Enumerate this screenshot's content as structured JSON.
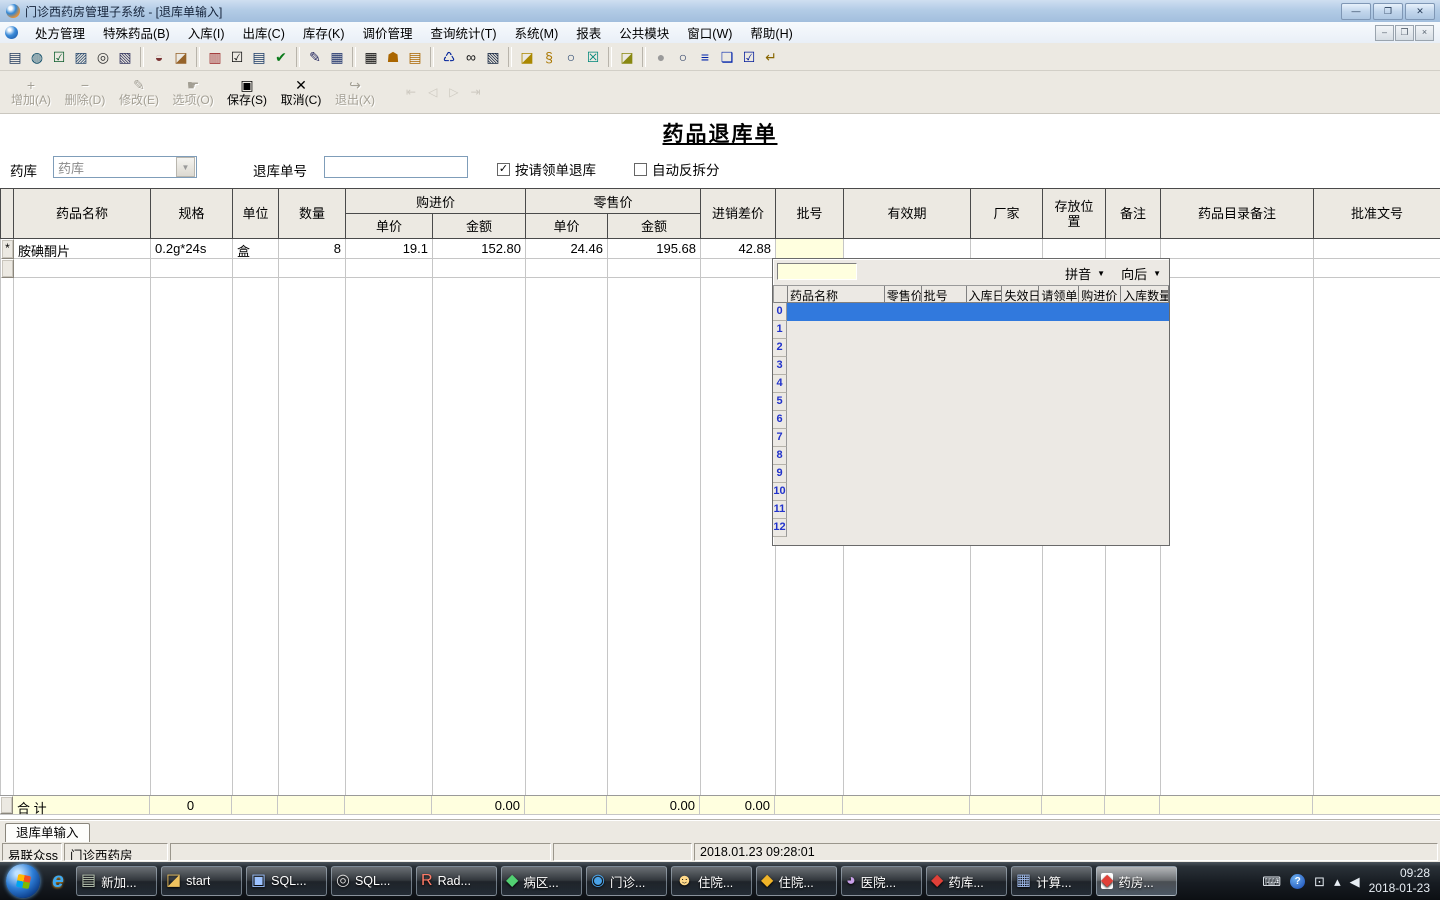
{
  "window": {
    "title": "门诊西药房管理子系统 - [退库单输入]"
  },
  "menu": {
    "items": [
      "处方管理",
      "特殊药品(B)",
      "入库(I)",
      "出库(C)",
      "库存(K)",
      "调价管理",
      "查询统计(T)",
      "系统(M)",
      "报表",
      "公共模块",
      "窗口(W)",
      "帮助(H)"
    ]
  },
  "toolbar": {
    "icons": [
      {
        "name": "print",
        "glyph": "▤",
        "color": "#223a5e"
      },
      {
        "name": "vial",
        "glyph": "◍",
        "color": "#0a4a66"
      },
      {
        "name": "approve",
        "glyph": "☑",
        "color": "#0a5c2a"
      },
      {
        "name": "doc-search",
        "glyph": "▨",
        "color": "#2a4a6e"
      },
      {
        "name": "find-doc",
        "glyph": "◎",
        "color": "#333333"
      },
      {
        "name": "audit-doc",
        "glyph": "▧",
        "color": "#33355e"
      },
      {
        "name": "vial-x",
        "glyph": "◒",
        "color": "#7a3333"
      },
      {
        "name": "new-folder",
        "glyph": "◪",
        "color": "#96632a"
      },
      {
        "name": "clipboard-add",
        "glyph": "▥",
        "color": "#992222"
      },
      {
        "name": "clipboard-check",
        "glyph": "☑",
        "color": "#111111"
      },
      {
        "name": "clipboard-doc",
        "glyph": "▤",
        "color": "#1a3a66"
      },
      {
        "name": "clipboard-ok",
        "glyph": "✔",
        "color": "#0a7a1a"
      },
      {
        "name": "edit-note",
        "glyph": "✎",
        "color": "#22255e"
      },
      {
        "name": "edit-window",
        "glyph": "▦",
        "color": "#23376e"
      },
      {
        "name": "keypad",
        "glyph": "▦",
        "color": "#111111"
      },
      {
        "name": "bell",
        "glyph": "☗",
        "color": "#aa6600"
      },
      {
        "name": "calendar",
        "glyph": "▤",
        "color": "#aa6600"
      },
      {
        "name": "trash",
        "glyph": "♺",
        "color": "#00229a"
      },
      {
        "name": "binoculars",
        "glyph": "∞",
        "color": "#111111"
      },
      {
        "name": "find-window",
        "glyph": "▧",
        "color": "#12233e"
      },
      {
        "name": "folder-open",
        "glyph": "◪",
        "color": "#aa8800"
      },
      {
        "name": "key",
        "glyph": "§",
        "color": "#aa7700"
      },
      {
        "name": "search",
        "glyph": "○",
        "color": "#1a3a66"
      },
      {
        "name": "close-box",
        "glyph": "☒",
        "color": "#00877a"
      },
      {
        "name": "export-folder",
        "glyph": "◪",
        "color": "#888811"
      },
      {
        "name": "sphere",
        "glyph": "●",
        "color": "#9a9a9a"
      },
      {
        "name": "zoom",
        "glyph": "○",
        "color": "#22355e"
      },
      {
        "name": "list",
        "glyph": "≡",
        "color": "#0022aa"
      },
      {
        "name": "layers",
        "glyph": "❏",
        "color": "#0022aa"
      },
      {
        "name": "verify",
        "glyph": "☑",
        "color": "#001999"
      },
      {
        "name": "exit-note",
        "glyph": "↵",
        "color": "#886600"
      }
    ]
  },
  "actionbar": {
    "buttons": [
      {
        "name": "add",
        "label": "增加(A)",
        "icon": "+",
        "enabled": false
      },
      {
        "name": "delete",
        "label": "删除(D)",
        "icon": "−",
        "enabled": false
      },
      {
        "name": "modify",
        "label": "修改(E)",
        "icon": "✎",
        "enabled": false
      },
      {
        "name": "options",
        "label": "选项(O)",
        "icon": "☛",
        "enabled": false
      },
      {
        "name": "save",
        "label": "保存(S)",
        "icon": "▣",
        "enabled": true
      },
      {
        "name": "cancel",
        "label": "取消(C)",
        "icon": "✕",
        "enabled": true
      },
      {
        "name": "exit",
        "label": "退出(X)",
        "icon": "↪",
        "enabled": false
      }
    ],
    "nav": [
      "⇤",
      "◁",
      "▷",
      "⇥"
    ]
  },
  "form": {
    "doc_title": "药品退库单",
    "warehouse_label": "药库",
    "warehouse_value": "药库",
    "order_no_label": "退库单号",
    "order_no_value": "",
    "by_request_label": "按请领单退库",
    "by_request_checked": "✓",
    "auto_split_label": "自动反拆分"
  },
  "grid": {
    "columns": {
      "drug": "药品名称",
      "spec": "规格",
      "unit": "单位",
      "qty": "数量",
      "purchase": "购进价",
      "retail": "零售价",
      "price": "单价",
      "amount": "金额",
      "diff": "进销差价",
      "batch": "批号",
      "expiry": "有效期",
      "maker": "厂家",
      "location": "存放位置",
      "remark": "备注",
      "catalog_remark": "药品目录备注",
      "approval": "批准文号"
    },
    "row": {
      "marker": "*",
      "drug": "胺碘酮片",
      "spec": "0.2g*24s",
      "unit": "盒",
      "qty": "8",
      "purchase_price": "19.1",
      "purchase_amount": "152.80",
      "retail_price": "24.46",
      "retail_amount": "195.68",
      "diff": "42.88"
    },
    "totals": {
      "label": "合  计",
      "qty": "0",
      "purchase_amount": "0.00",
      "retail_amount": "0.00",
      "diff": "0.00"
    }
  },
  "popup": {
    "search_value": "",
    "sort_label": "拼音",
    "dir_label": "向后",
    "columns": [
      "药品名称",
      "零售价",
      "批号",
      "入库日",
      "失效日",
      "请领单",
      "购进价",
      "入库数量"
    ],
    "row_numbers": [
      "0",
      "1",
      "2",
      "3",
      "4",
      "5",
      "6",
      "7",
      "8",
      "9",
      "10",
      "11",
      "12"
    ],
    "selection_color": "#3179dd"
  },
  "tabs": [
    "退库单输入"
  ],
  "statusbar": {
    "s1": "易联众ss",
    "s2": "门诊西药房",
    "s3": "",
    "s4": "",
    "time": "2018.01.23 09:28:01"
  },
  "taskbar": {
    "quicklaunch_ie": "e",
    "buttons": [
      {
        "name": "new-disk",
        "label": "新加...",
        "glyph": "▤",
        "color": "#b9c6b2",
        "active": false
      },
      {
        "name": "start-folder",
        "label": "start",
        "glyph": "◪",
        "color": "#eec25e",
        "active": false
      },
      {
        "name": "sql-analyzer",
        "label": "SQL...",
        "glyph": "▣",
        "color": "#9cc2ff",
        "active": false
      },
      {
        "name": "sql-manager",
        "label": "SQL...",
        "glyph": "◎",
        "color": "#d8d8d8",
        "active": false
      },
      {
        "name": "radasm",
        "label": "Rad...",
        "glyph": "R",
        "color": "#ff7a66",
        "active": false
      },
      {
        "name": "ward",
        "label": "病区...",
        "glyph": "◆",
        "color": "#52d072",
        "active": false
      },
      {
        "name": "clinic",
        "label": "门诊...",
        "glyph": "◉",
        "color": "#4aa3e8",
        "active": false
      },
      {
        "name": "inpatient-reg",
        "label": "住院...",
        "glyph": "☻",
        "color": "#ffd98a",
        "active": false
      },
      {
        "name": "inpatient-gold",
        "label": "住院...",
        "glyph": "◆",
        "color": "#f0b428",
        "active": false
      },
      {
        "name": "hospital-stats",
        "label": "医院...",
        "glyph": "◕",
        "color": "#c9a0e8",
        "active": false
      },
      {
        "name": "drug-store",
        "label": "药库...",
        "glyph": "◆",
        "color": "#e04038",
        "active": false
      },
      {
        "name": "calculator",
        "label": "计算...",
        "glyph": "▦",
        "color": "#9db8e8",
        "active": false
      },
      {
        "name": "pharmacy",
        "label": "药房...",
        "glyph": "◆",
        "color": "#e04038",
        "active": true
      }
    ],
    "tray": {
      "keyboard": "⌨",
      "help": "?",
      "window": "⊡",
      "expand": "▴",
      "volume": "◀",
      "time": "09:28",
      "date": "2018-01-23"
    }
  }
}
